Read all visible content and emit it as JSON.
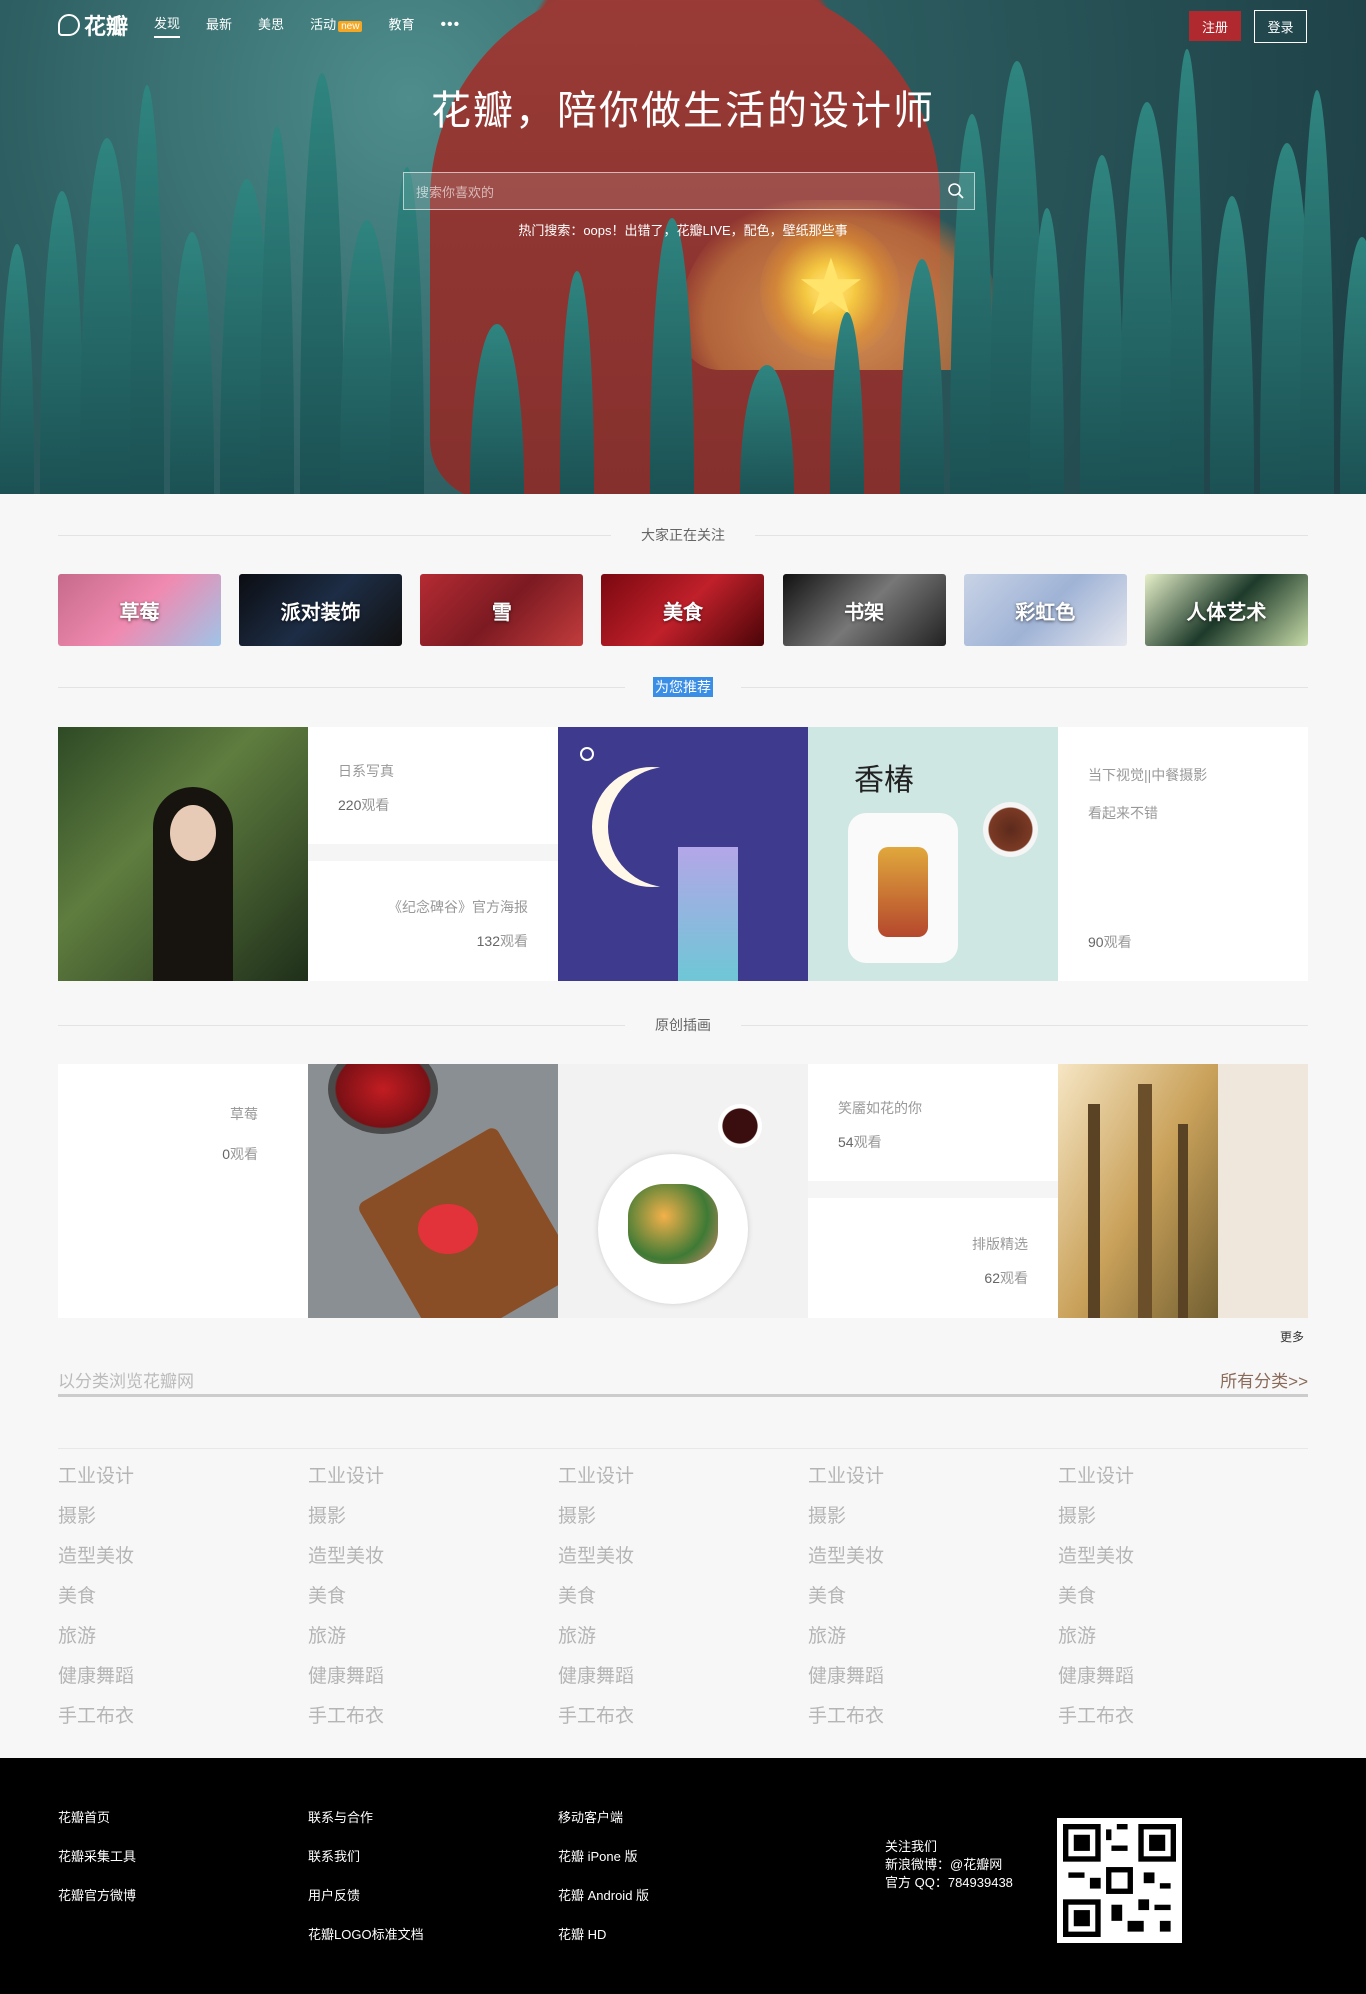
{
  "nav": {
    "logo": "花瓣",
    "links": [
      {
        "label": "发现",
        "active": true
      },
      {
        "label": "最新"
      },
      {
        "label": "美思"
      },
      {
        "label": "活动",
        "badge": "new"
      },
      {
        "label": "教育"
      }
    ],
    "more": "•••",
    "register": "注册",
    "login": "登录"
  },
  "hero": {
    "slogan": "花瓣，陪你做生活的设计师",
    "search_placeholder": "搜索你喜欢的",
    "hot_search": "热门搜索：oops！出错了，花瓣LIVE，配色，壁纸那些事"
  },
  "sections": {
    "following": "大家正在关注",
    "recommend": "为您推荐",
    "illustration": "原创插画"
  },
  "tags": [
    {
      "label": "草莓",
      "colors": [
        "#c66a8a",
        "#f08ab0",
        "#9ec4e8"
      ]
    },
    {
      "label": "派对装饰",
      "colors": [
        "#0b0d12",
        "#1d2d45",
        "#111"
      ]
    },
    {
      "label": "雪",
      "colors": [
        "#b52b33",
        "#7c1a22",
        "#c23c3c"
      ]
    },
    {
      "label": "美食",
      "colors": [
        "#7a0810",
        "#c0202a",
        "#4a0508"
      ]
    },
    {
      "label": "书架",
      "colors": [
        "#111",
        "#777",
        "#222"
      ]
    },
    {
      "label": "彩虹色",
      "colors": [
        "#c9d3e6",
        "#9fb3d6",
        "#e5e7ee"
      ]
    },
    {
      "label": "人体艺术",
      "colors": [
        "#e6f0c9",
        "#1d3a2a",
        "#c7dba8"
      ]
    }
  ],
  "recommend": {
    "a": {
      "title": "日系写真",
      "views": "220",
      "unit": "观看"
    },
    "b": {
      "title": "《纪念碑谷》官方海报",
      "views": "132",
      "unit": "观看"
    },
    "c": {
      "title": "当下视觉||中餐摄影",
      "subtitle": "看起来不错",
      "views": "90",
      "unit": "观看"
    },
    "food_brand": "香椿"
  },
  "illustration": {
    "a": {
      "title": "草莓",
      "views": "0",
      "unit": "观看"
    },
    "b": {
      "title": "笑靥如花的你",
      "views": "54",
      "unit": "观看"
    },
    "c": {
      "title": "排版精选",
      "views": "62",
      "unit": "观看"
    }
  },
  "more": "更多",
  "browse": {
    "title": "以分类浏览花瓣网",
    "all": "所有分类>>"
  },
  "categories": [
    "工业设计",
    "摄影",
    "造型美妆",
    "美食",
    "旅游",
    "健康舞蹈",
    "手工布衣"
  ],
  "footer": {
    "col1": [
      "花瓣首页",
      "花瓣采集工具",
      "花瓣官方微博"
    ],
    "col2": [
      "联系与合作",
      "联系我们",
      "用户反馈",
      "花瓣LOGO标准文档"
    ],
    "col3": [
      "移动客户端",
      "花瓣 iPone 版",
      "花瓣 Android 版",
      "花瓣 HD"
    ],
    "follow": {
      "title": "关注我们",
      "weibo": "新浪微博：@花瓣网",
      "qq": "官方 QQ：784939438"
    }
  }
}
